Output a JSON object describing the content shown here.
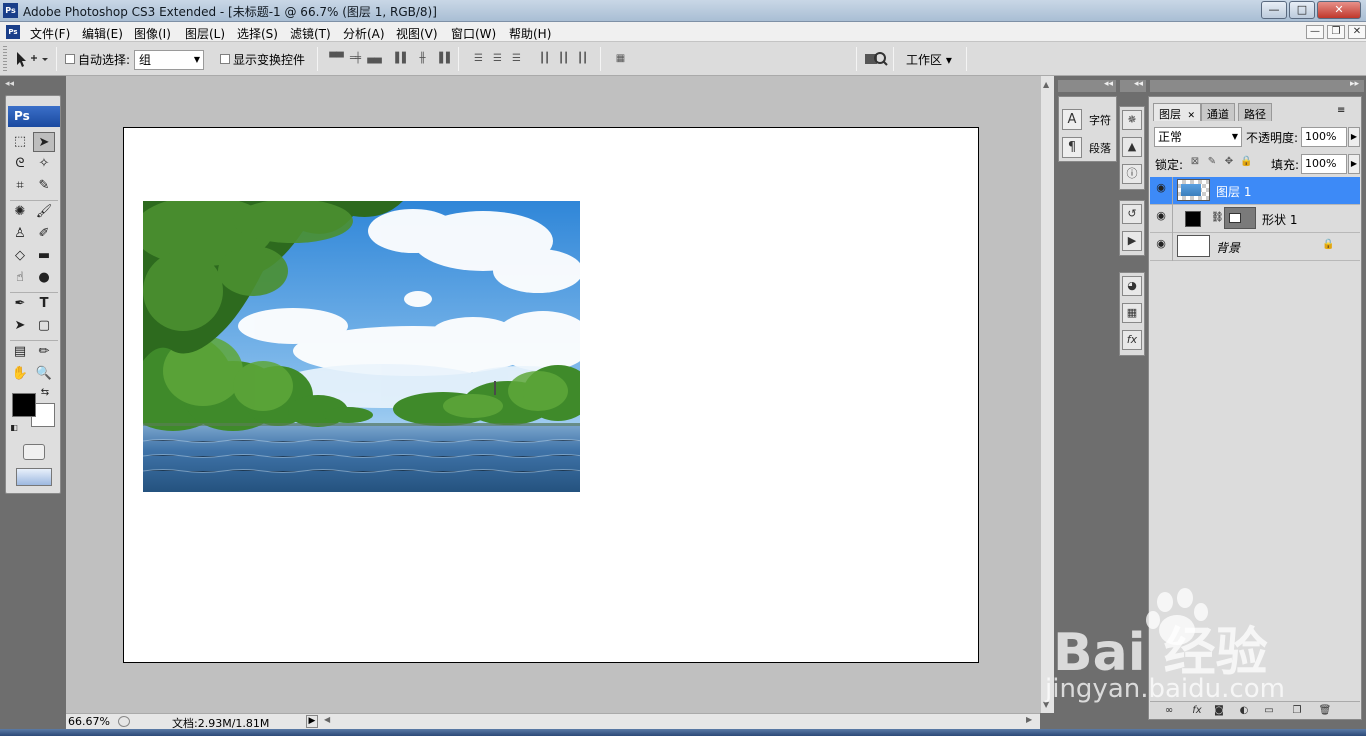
{
  "window": {
    "icon_label": "Ps",
    "title": "Adobe Photoshop CS3 Extended - [未标题-1 @ 66.7% (图层 1, RGB/8)]",
    "min_label": "—",
    "max_label": "□",
    "close_label": "✕"
  },
  "menu": {
    "items": [
      "文件(F)",
      "编辑(E)",
      "图像(I)",
      "图层(L)",
      "选择(S)",
      "滤镜(T)",
      "分析(A)",
      "视图(V)",
      "窗口(W)",
      "帮助(H)"
    ],
    "doc_min": "—",
    "doc_restore": "❐",
    "doc_close": "✕"
  },
  "options": {
    "auto_select_label": "自动选择:",
    "auto_select_value": "组",
    "show_transform_label": "显示变换控件",
    "workspace_label": "工作区 ▾"
  },
  "toolbox": {
    "logo": "Ps"
  },
  "statusbar": {
    "zoom": "66.67%",
    "doc_info": "文档:2.93M/1.81M"
  },
  "char_panel": {
    "char_label": "字符",
    "para_label": "段落"
  },
  "layers_panel": {
    "tabs": [
      "图层",
      "通道",
      "路径"
    ],
    "blend_mode": "正常",
    "opacity_label": "不透明度:",
    "opacity_value": "100%",
    "lock_label": "锁定:",
    "fill_label": "填充:",
    "fill_value": "100%",
    "layers": [
      {
        "name": "图层 1",
        "selected": true
      },
      {
        "name": "形状 1",
        "selected": false
      },
      {
        "name": "背景",
        "selected": false
      }
    ],
    "bottom_icons": [
      "link-icon",
      "fx-icon",
      "mask-icon",
      "adjustment-icon",
      "folder-icon",
      "new-layer-icon",
      "trash-icon"
    ]
  },
  "watermark": {
    "main": "Bai 经验",
    "sub": "jingyan.baidu.com"
  },
  "colors": {
    "selection_blue": "#3d8af7",
    "workspace_gray": "#c0c0c0",
    "panel_gray": "#dcdcdc"
  }
}
